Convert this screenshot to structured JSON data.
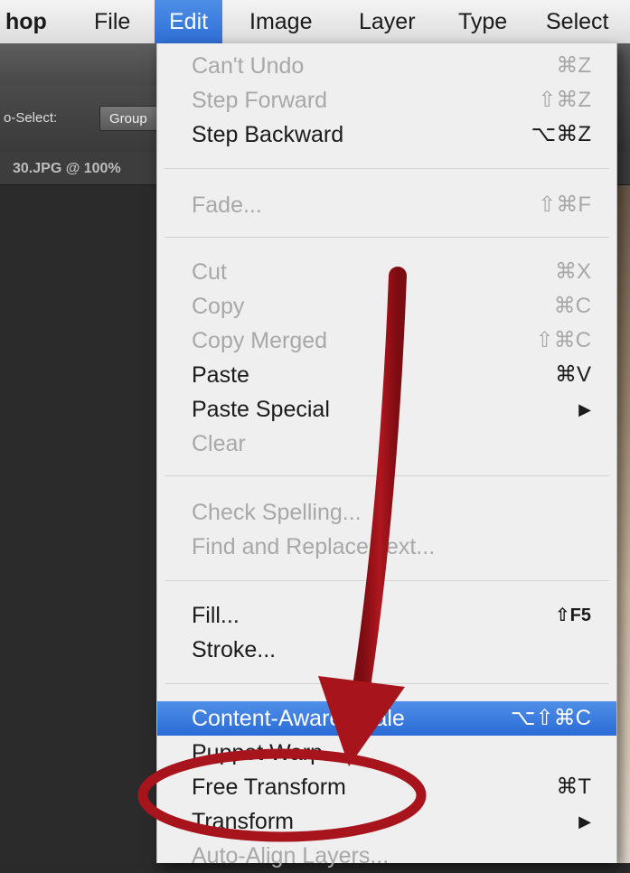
{
  "menubar": {
    "app": "hop",
    "items": [
      "File",
      "Edit",
      "Image",
      "Layer",
      "Type",
      "Select"
    ]
  },
  "toolbar": {
    "auto_select": "o-Select:",
    "group_value": "Group"
  },
  "document": {
    "tab_title": "30.JPG @ 100%"
  },
  "edit_menu": {
    "items": [
      {
        "label": "Can't Undo",
        "shortcut": "⌘Z",
        "enabled": false
      },
      {
        "label": "Step Forward",
        "shortcut": "⇧⌘Z",
        "enabled": false
      },
      {
        "label": "Step Backward",
        "shortcut": "⌥⌘Z",
        "enabled": true
      },
      {
        "label": "Fade...",
        "shortcut": "⇧⌘F",
        "enabled": false
      },
      {
        "label": "Cut",
        "shortcut": "⌘X",
        "enabled": false
      },
      {
        "label": "Copy",
        "shortcut": "⌘C",
        "enabled": false
      },
      {
        "label": "Copy Merged",
        "shortcut": "⇧⌘C",
        "enabled": false
      },
      {
        "label": "Paste",
        "shortcut": "⌘V",
        "enabled": true
      },
      {
        "label": "Paste Special",
        "shortcut": "▶",
        "enabled": true
      },
      {
        "label": "Clear",
        "shortcut": "",
        "enabled": false
      },
      {
        "label": "Check Spelling...",
        "shortcut": "",
        "enabled": false
      },
      {
        "label": "Find and Replace Text...",
        "shortcut": "",
        "enabled": false
      },
      {
        "label": "Fill...",
        "shortcut": "⇧F5",
        "enabled": true
      },
      {
        "label": "Stroke...",
        "shortcut": "",
        "enabled": true
      },
      {
        "label": "Content-Aware Scale",
        "shortcut": "⌥⇧⌘C",
        "enabled": true,
        "highlighted": true
      },
      {
        "label": "Puppet Warp",
        "shortcut": "",
        "enabled": true
      },
      {
        "label": "Free Transform",
        "shortcut": "⌘T",
        "enabled": true
      },
      {
        "label": "Transform",
        "shortcut": "▶",
        "enabled": true
      },
      {
        "label": "Auto-Align Layers...",
        "shortcut": "",
        "enabled": false
      }
    ]
  },
  "colors": {
    "menu_highlight": "#2f6fd6",
    "annotation_red": "#a8141c"
  }
}
